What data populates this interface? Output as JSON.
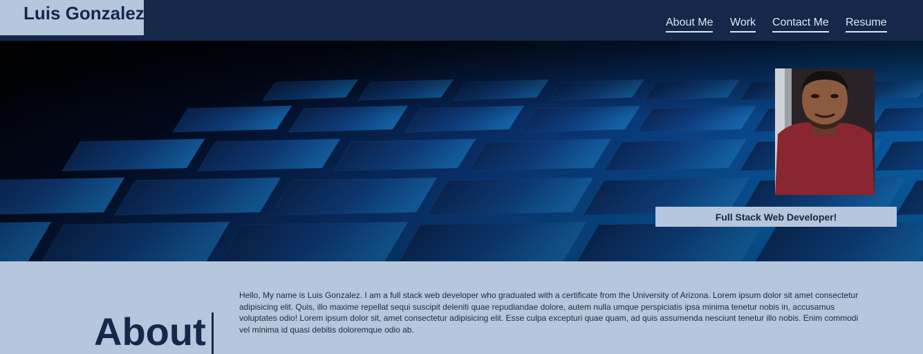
{
  "header": {
    "brand_name": "Luis Gonzalez",
    "nav": [
      {
        "label": "About Me"
      },
      {
        "label": "Work"
      },
      {
        "label": "Contact Me"
      },
      {
        "label": "Resume"
      }
    ]
  },
  "hero": {
    "background_image": "keyboard-photo",
    "profile_photo": "profile-photo",
    "tagline": "Full Stack Web Developer!"
  },
  "about": {
    "title": "About",
    "text": "Hello, My name is Luis Gonzalez. I am a full stack web developer who graduated with a certificate from the University of Arizona. Lorem ipsum dolor sit amet consectetur adipisicing elit. Quis, illo maxime repellat sequi suscipit deleniti quae repudiandae dolore, autem nulla umque perspiciatis ipsa minima tenetur nobis in, accusamus voluptates odio! Lorem ipsum dolor sit, amet consectetur adipisicing elit. Esse culpa excepturi quae quam, ad quis assumenda nesciunt tenetur illo nobis. Enim commodi vel minima id quasi debitis doloremque odio ab."
  },
  "colors": {
    "navbar": "#15284a",
    "light_blue": "#b5c6dd",
    "text_dark": "#15284a"
  }
}
